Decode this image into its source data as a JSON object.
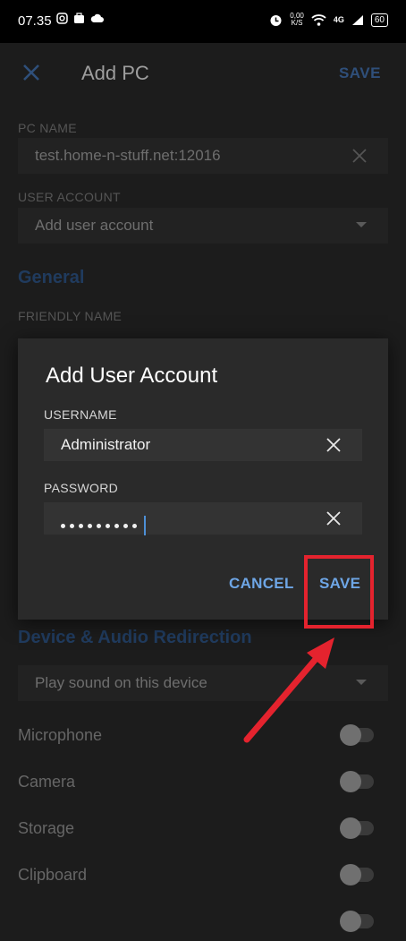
{
  "status_bar": {
    "time": "07.35",
    "net_speed_value": "0,00",
    "net_speed_unit": "K/S",
    "network": "4G",
    "battery": "60",
    "icons": [
      "instagram-icon",
      "briefcase-icon",
      "cloud-icon",
      "alarm-icon",
      "wifi-icon",
      "signal-icon",
      "battery-icon"
    ]
  },
  "toolbar": {
    "title": "Add PC",
    "save_label": "SAVE"
  },
  "form": {
    "pc_name_label": "PC NAME",
    "pc_name_value": "test.home-n-stuff.net:12016",
    "user_account_label": "USER ACCOUNT",
    "user_account_value": "Add user account",
    "general_heading": "General",
    "friendly_name_label": "FRIENDLY NAME",
    "device_audio_heading": "Device & Audio Redirection",
    "sound_option": "Play sound on this device",
    "toggles": [
      {
        "label": "Microphone",
        "on": false
      },
      {
        "label": "Camera",
        "on": false
      },
      {
        "label": "Storage",
        "on": false
      },
      {
        "label": "Clipboard",
        "on": false
      }
    ]
  },
  "dialog": {
    "title": "Add User Account",
    "username_label": "USERNAME",
    "username_value": "Administrator",
    "password_label": "PASSWORD",
    "password_masked_length": 9,
    "cancel_label": "CANCEL",
    "save_label": "SAVE"
  },
  "colors": {
    "accent": "#6ea6e6",
    "annotation": "#e4232e",
    "section_heading": "#203b5e"
  }
}
